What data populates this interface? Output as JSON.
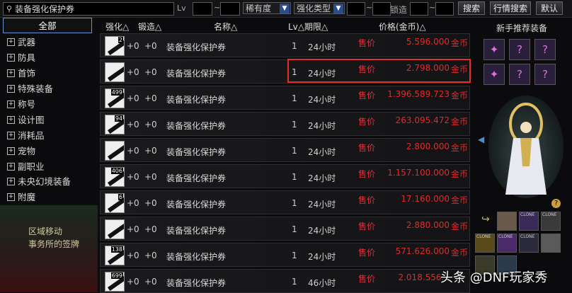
{
  "search": {
    "value": "装备强化保护券"
  },
  "filters": {
    "lv_label": "Lv",
    "tilde": "~",
    "rarity": "稀有度",
    "enhance_type": "强化类型",
    "lock_label": "锁造"
  },
  "buttons": {
    "search": "搜索",
    "price_search": "行情搜索",
    "default": "默认"
  },
  "categories": {
    "active": "全部",
    "items": [
      "武器",
      "防具",
      "首饰",
      "特殊装备",
      "称号",
      "设计图",
      "消耗品",
      "宠物",
      "副职业",
      "未央幻境装备",
      "附魔"
    ]
  },
  "columns": {
    "enhance": "强化△",
    "forge": "锻造△",
    "name": "名称△",
    "lv_period": "Lv△期限△",
    "price": "价格(金币)△"
  },
  "listings": [
    {
      "count": "2",
      "enhance": "+0",
      "forge": "+0",
      "name": "装备强化保护券",
      "lv": "1",
      "period": "24小时",
      "sale": "售价",
      "price": "5.596.000",
      "unit": "金币"
    },
    {
      "count": "",
      "enhance": "+0",
      "forge": "+0",
      "name": "装备强化保护券",
      "lv": "1",
      "period": "24小时",
      "sale": "售价",
      "price": "2.798.000",
      "unit": "金币"
    },
    {
      "count": "499",
      "enhance": "+0",
      "forge": "+0",
      "name": "装备强化保护券",
      "lv": "1",
      "period": "24小时",
      "sale": "售价",
      "price": "1.396.589.723",
      "unit": "金币"
    },
    {
      "count": "94",
      "enhance": "+0",
      "forge": "+0",
      "name": "装备强化保护券",
      "lv": "1",
      "period": "24小时",
      "sale": "售价",
      "price": "263.095.472",
      "unit": "金币"
    },
    {
      "count": "",
      "enhance": "+0",
      "forge": "+0",
      "name": "装备强化保护券",
      "lv": "1",
      "period": "24小时",
      "sale": "售价",
      "price": "2.800.000",
      "unit": "金币"
    },
    {
      "count": "406",
      "enhance": "+0",
      "forge": "+0",
      "name": "装备强化保护券",
      "lv": "1",
      "period": "24小时",
      "sale": "售价",
      "price": "1.157.100.000",
      "unit": "金币"
    },
    {
      "count": "6",
      "enhance": "+0",
      "forge": "+0",
      "name": "装备强化保护券",
      "lv": "1",
      "period": "24小时",
      "sale": "售价",
      "price": "17.160.000",
      "unit": "金币"
    },
    {
      "count": "",
      "enhance": "+0",
      "forge": "+0",
      "name": "装备强化保护券",
      "lv": "1",
      "period": "24小时",
      "sale": "售价",
      "price": "2.880.000",
      "unit": "金币"
    },
    {
      "count": "138",
      "enhance": "+0",
      "forge": "+0",
      "name": "装备强化保护券",
      "lv": "1",
      "period": "24小时",
      "sale": "售价",
      "price": "571.626.000",
      "unit": "金币"
    },
    {
      "count": "699",
      "enhance": "+0",
      "forge": "+0",
      "name": "装备强化保护券",
      "lv": "1",
      "period": "46小时",
      "sale": "售价",
      "price": "2.018.556.1",
      "unit": ""
    }
  ],
  "right_panel": {
    "title": "新手推荐装备",
    "help": "?"
  },
  "background_text": {
    "line1": "区域移动",
    "line2": "事务所的签牌"
  },
  "watermark": "头条 @DNF玩家秀"
}
